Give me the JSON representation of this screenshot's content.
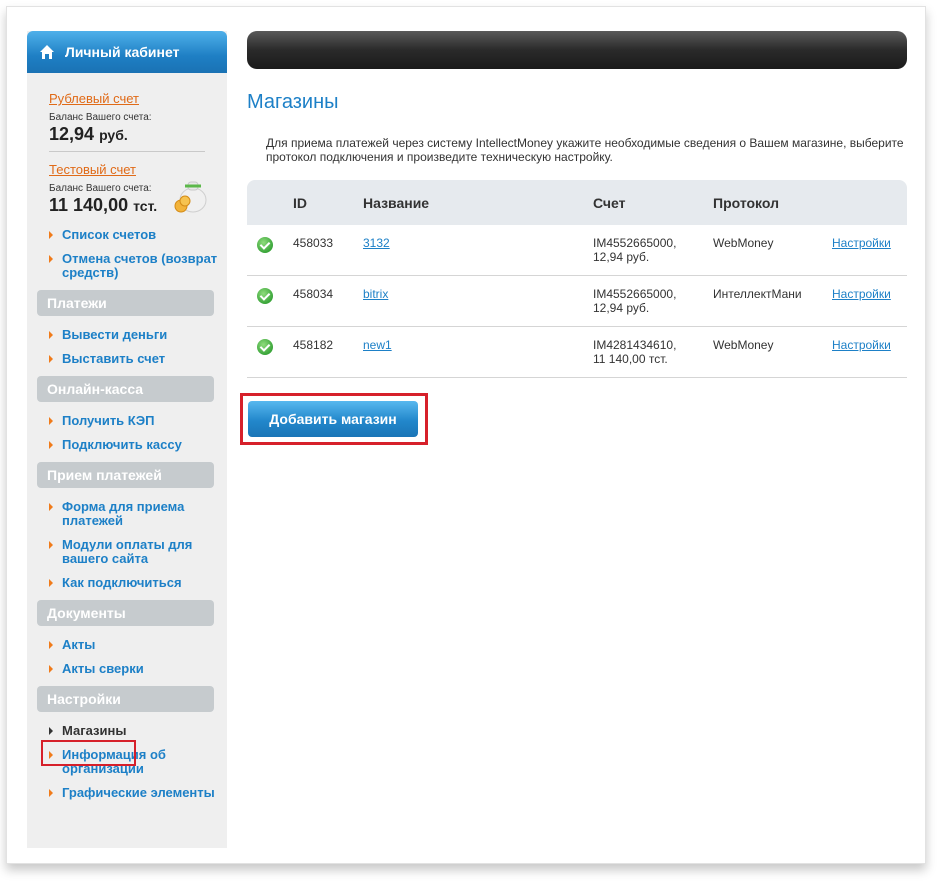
{
  "sidebar": {
    "title": "Личный кабинет",
    "accounts": [
      {
        "link": "Рублевый счет",
        "caption": "Баланс Вашего счета:",
        "amount": "12,94",
        "currency": "руб."
      },
      {
        "link": "Тестовый счет",
        "caption": "Баланс Вашего счета:",
        "amount": "11 140,00",
        "currency": "тст."
      }
    ],
    "account_menu": [
      "Список счетов",
      "Отмена счетов (возврат средств)"
    ],
    "sections": [
      {
        "title": "Платежи",
        "items": [
          "Вывести деньги",
          "Выставить счет"
        ]
      },
      {
        "title": "Онлайн-касса",
        "items": [
          "Получить КЭП",
          "Подключить кассу"
        ]
      },
      {
        "title": "Прием платежей",
        "items": [
          "Форма для приема платежей",
          "Модули оплаты для вашего сайта",
          "Как подключиться"
        ]
      },
      {
        "title": "Документы",
        "items": [
          "Акты",
          "Акты сверки"
        ]
      },
      {
        "title": "Настройки",
        "items": [
          "Магазины",
          "Информация об организации",
          "Графические элементы"
        ]
      }
    ],
    "active_item": "Магазины"
  },
  "content": {
    "title": "Магазины",
    "intro": "Для приема платежей через систему IntellectMoney укажите необходимые сведения о Вашем магазине, выберите протокол подключения и произведите техническую настройку.",
    "columns": [
      "ID",
      "Название",
      "Счет",
      "Протокол"
    ],
    "rows": [
      {
        "id": "458033",
        "name": "3132",
        "account": "IM4552665000,",
        "balance": "12,94 руб.",
        "protocol": "WebMoney",
        "action": "Настройки"
      },
      {
        "id": "458034",
        "name": "bitrix",
        "account": "IM4552665000,",
        "balance": "12,94 руб.",
        "protocol": "ИнтеллектМани",
        "action": "Настройки"
      },
      {
        "id": "458182",
        "name": "new1",
        "account": "IM4281434610,",
        "balance": "11 140,00 тст.",
        "protocol": "WebMoney",
        "action": "Настройки"
      }
    ],
    "add_button": "Добавить магазин"
  },
  "colors": {
    "accent": "#1d80c7",
    "orange": "#e06a17",
    "highlight": "#d6202a"
  }
}
